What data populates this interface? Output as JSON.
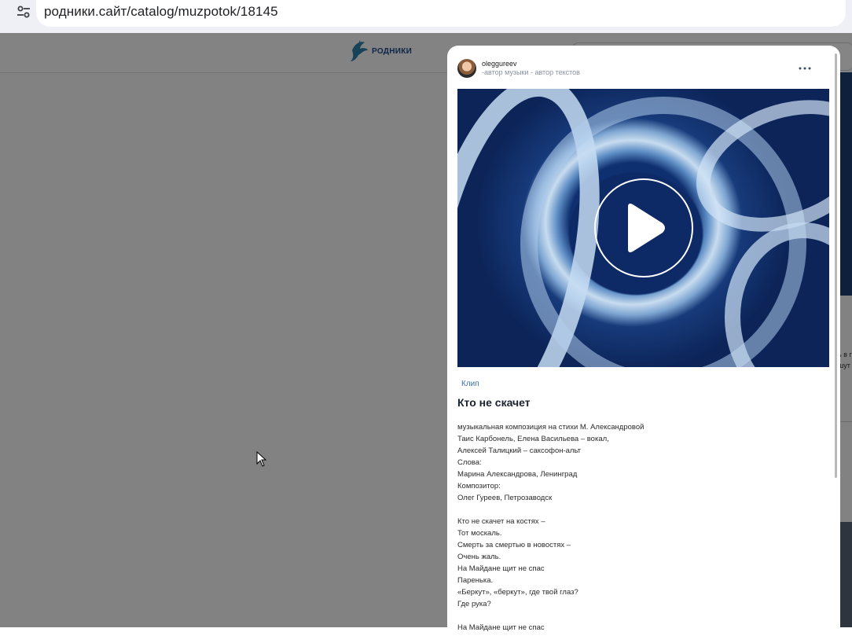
{
  "browser": {
    "url": "родники.сайт/catalog/muzpotok/18145",
    "site_info_icon": "tune-icon"
  },
  "site": {
    "logo_text": "РОДНИКИ"
  },
  "right_peek": {
    "line1": "ь в г",
    "line2": "шут"
  },
  "post": {
    "author": "oleggureev",
    "roles": "-автор музыки - автор текстов",
    "more_icon": "more-horizontal-icon",
    "tag": "Клип",
    "title": "Кто не скачет",
    "lines": [
      "музыкальная композиция на стихи М. Александровой",
      "Таис Карбонель, Елена Васильева – вокал,",
      "Алексей Талицкий – саксофон-альт",
      "Слова:",
      "Марина Александрова, Ленинград",
      "Композитор:",
      "Олег Гуреев, Петрозаводск",
      "",
      "Кто не скачет на костях –",
      "Тот москаль.",
      "Смерть за смертью в новостях –",
      "Очень жаль.",
      "На Майдане щит не спас",
      "Паренька.",
      "«Беркут», «беркут», где твой глаз?",
      "Где рука?",
      "",
      "На Майдане щит не спас"
    ]
  },
  "colors": {
    "link": "#3a6fb0",
    "brand": "#1b4a8a"
  }
}
